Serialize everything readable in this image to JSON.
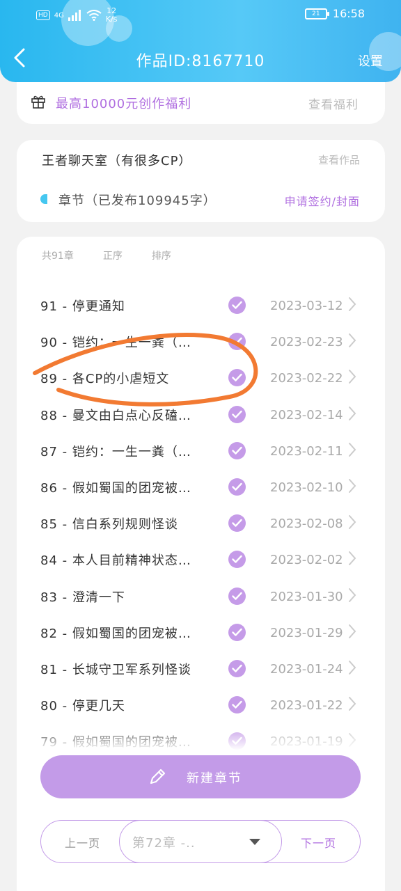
{
  "status_bar": {
    "hd": "HD",
    "signal": "4G",
    "speed_value": "12",
    "speed_unit": "K/s",
    "battery": "21",
    "time": "16:58"
  },
  "nav": {
    "title": "作品ID:8167710",
    "settings_label": "设置"
  },
  "welfare": {
    "text": "最高10000元创作福利",
    "link": "查看福利"
  },
  "work": {
    "title": "王者聊天室（有很多CP）",
    "view_link": "查看作品",
    "chapter_label": "章节（已发布109945字）",
    "sign_link": "申请签约/封面"
  },
  "filters": {
    "total": "共91章",
    "order": "正序",
    "sort": "排序"
  },
  "chapters": [
    {
      "title": "91 - 停更通知",
      "date": "2023-03-12"
    },
    {
      "title": "90 - 铠约：一生一粪（…",
      "date": "2023-02-23"
    },
    {
      "title": "89 - 各CP的小虐短文",
      "date": "2023-02-22"
    },
    {
      "title": "88 - 曼文由白点心反磕…",
      "date": "2023-02-14"
    },
    {
      "title": "87 - 铠约：一生一粪（…",
      "date": "2023-02-11"
    },
    {
      "title": "86 - 假如蜀国的团宠被…",
      "date": "2023-02-10"
    },
    {
      "title": "85 - 信白系列规则怪谈",
      "date": "2023-02-08"
    },
    {
      "title": "84 - 本人目前精神状态…",
      "date": "2023-02-02"
    },
    {
      "title": "83 - 澄清一下",
      "date": "2023-01-30"
    },
    {
      "title": "82 - 假如蜀国的团宠被…",
      "date": "2023-01-29"
    },
    {
      "title": "81 - 长城守卫军系列怪谈",
      "date": "2023-01-24"
    },
    {
      "title": "80 - 停更几天",
      "date": "2023-01-22"
    },
    {
      "title": "79 - 假如蜀国的团宠被…",
      "date": "2023-01-19"
    }
  ],
  "new_chapter_label": "新建章节",
  "pager": {
    "prev": "上一页",
    "current": "第72章 -..",
    "next": "下一页"
  },
  "colors": {
    "header": "#3bbdf2",
    "accent": "#c39be8",
    "accent_text": "#b06fe0",
    "annotation": "#f27a32"
  }
}
